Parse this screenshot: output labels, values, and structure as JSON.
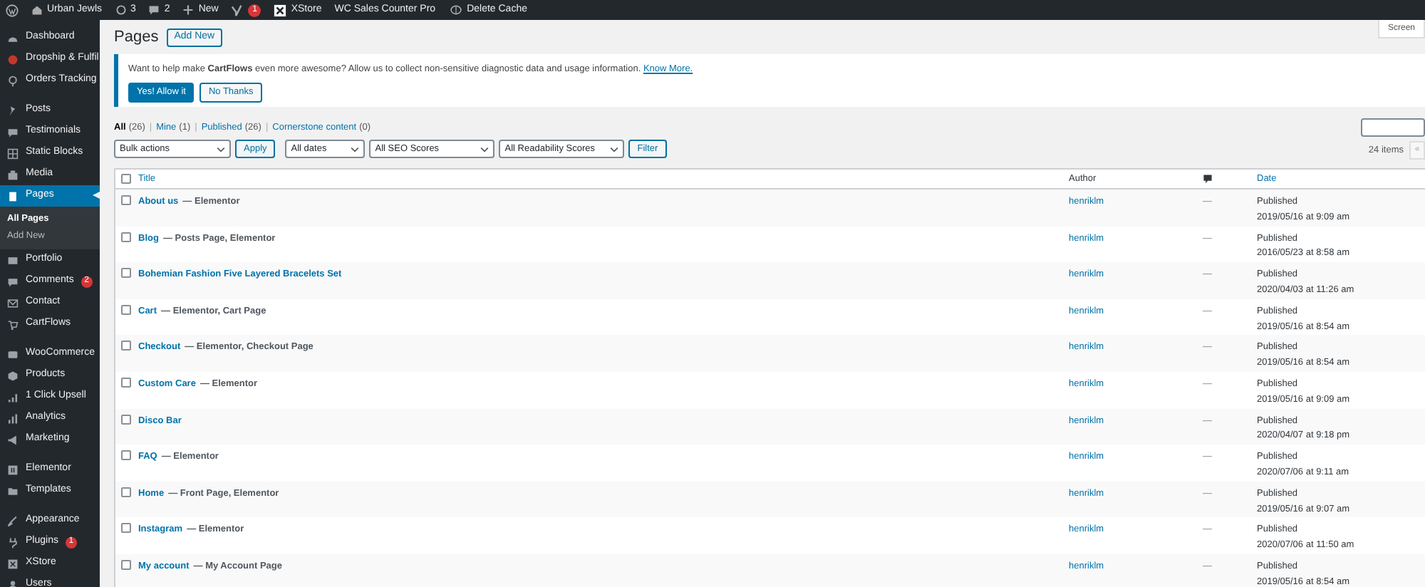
{
  "admin_bar": {
    "site": "Urban Jewls",
    "updates": "3",
    "comments": "2",
    "new": "New",
    "seo_badge": "1",
    "xstore": "XStore",
    "sales_counter": "WC Sales Counter Pro",
    "delete_cache": "Delete Cache"
  },
  "screen_options": "Screen",
  "sidebar": {
    "groups": [
      [
        {
          "label": "Dashboard",
          "selected": false
        },
        {
          "label": "Dropship & Fulfil",
          "selected": false
        },
        {
          "label": "Orders Tracking",
          "selected": false
        }
      ],
      [
        {
          "label": "Posts",
          "selected": false
        },
        {
          "label": "Testimonials",
          "selected": false
        },
        {
          "label": "Static Blocks",
          "selected": false
        },
        {
          "label": "Media",
          "selected": false
        },
        {
          "label": "Pages",
          "selected": true,
          "children": [
            {
              "label": "All Pages",
              "selected": true
            },
            {
              "label": "Add New",
              "selected": false
            }
          ]
        },
        {
          "label": "Portfolio",
          "selected": false
        },
        {
          "label": "Comments",
          "selected": false,
          "badge": "2"
        },
        {
          "label": "Contact",
          "selected": false
        },
        {
          "label": "CartFlows",
          "selected": false
        }
      ],
      [
        {
          "label": "WooCommerce",
          "selected": false
        },
        {
          "label": "Products",
          "selected": false
        },
        {
          "label": "1 Click Upsell",
          "selected": false
        },
        {
          "label": "Analytics",
          "selected": false
        },
        {
          "label": "Marketing",
          "selected": false
        }
      ],
      [
        {
          "label": "Elementor",
          "selected": false
        },
        {
          "label": "Templates",
          "selected": false
        }
      ],
      [
        {
          "label": "Appearance",
          "selected": false
        },
        {
          "label": "Plugins",
          "selected": false,
          "badge": "1"
        },
        {
          "label": "XStore",
          "selected": false
        },
        {
          "label": "Users",
          "selected": false
        }
      ]
    ]
  },
  "page_title": "Pages",
  "add_new": "Add New",
  "notice": {
    "text": "Want to help make **CartFlows** even more awesome? Allow us to collect non-sensitive diagnostic data and usage information.",
    "link": "Know More.",
    "buttons": [
      {
        "label": "Yes! Allow it",
        "kind": "primary"
      },
      {
        "label": "No Thanks",
        "kind": "secondary"
      }
    ]
  },
  "views": [
    {
      "label": "All",
      "count": "(26)",
      "selected": true
    },
    {
      "separator": "|",
      "label": "Mine",
      "count": "(1)",
      "selected": false
    },
    {
      "separator": "|",
      "label": "Published",
      "count": "(26)",
      "selected": false
    },
    {
      "separator": "|",
      "label": "Cornerstone content",
      "count": "(0)",
      "selected": false
    }
  ],
  "filters": [
    {
      "kind": "select",
      "label": "Bulk actions"
    },
    {
      "kind": "button",
      "label": "Apply"
    },
    {
      "kind": "select",
      "label": "All dates"
    },
    {
      "kind": "select",
      "label": "All SEO Scores"
    },
    {
      "kind": "select",
      "label": "All Readability Scores"
    },
    {
      "kind": "button",
      "label": "Filter"
    }
  ],
  "items_count": "24 items",
  "pagination": "«",
  "table": {
    "columns": [
      "Title",
      "Author",
      "Date"
    ],
    "select_all_checked": false,
    "rows": [
      {
        "checked": false,
        "title": "About us",
        "state": "— Elementor",
        "author": "henriklm",
        "comments": "—",
        "status": "Published",
        "date": "2019/05/16 at 9:09 am"
      },
      {
        "checked": false,
        "title": "Blog",
        "state": "— Posts Page, Elementor",
        "author": "henriklm",
        "comments": "—",
        "status": "Published",
        "date": "2016/05/23 at 8:58 am"
      },
      {
        "checked": false,
        "title": "Bohemian Fashion Five Layered Bracelets Set",
        "author": "henriklm",
        "comments": "—",
        "status": "Published",
        "date": "2020/04/03 at 11:26 am"
      },
      {
        "checked": false,
        "title": "Cart",
        "state": "— Elementor, Cart Page",
        "author": "henriklm",
        "comments": "—",
        "status": "Published",
        "date": "2019/05/16 at 8:54 am"
      },
      {
        "checked": false,
        "title": "Checkout",
        "state": "— Elementor, Checkout Page",
        "author": "henriklm",
        "comments": "—",
        "status": "Published",
        "date": "2019/05/16 at 8:54 am"
      },
      {
        "checked": false,
        "title": "Custom Care",
        "state": "— Elementor",
        "author": "henriklm",
        "comments": "—",
        "status": "Published",
        "date": "2019/05/16 at 9:09 am"
      },
      {
        "checked": false,
        "title": "Disco Bar",
        "author": "henriklm",
        "comments": "—",
        "status": "Published",
        "date": "2020/04/07 at 9:18 pm"
      },
      {
        "checked": false,
        "title": "FAQ",
        "state": "— Elementor",
        "author": "henriklm",
        "comments": "—",
        "status": "Published",
        "date": "2020/07/06 at 9:11 am"
      },
      {
        "checked": false,
        "title": "Home",
        "state": "— Front Page, Elementor",
        "author": "henriklm",
        "comments": "—",
        "status": "Published",
        "date": "2019/05/16 at 9:07 am"
      },
      {
        "checked": false,
        "title": "Instagram",
        "state": "— Elementor",
        "author": "henriklm",
        "comments": "—",
        "status": "Published",
        "date": "2020/07/06 at 11:50 am"
      },
      {
        "checked": false,
        "title": "My account",
        "state": "— My Account Page",
        "author": "henriklm",
        "comments": "—",
        "status": "Published",
        "date": "2019/05/16 at 8:54 am"
      }
    ]
  }
}
